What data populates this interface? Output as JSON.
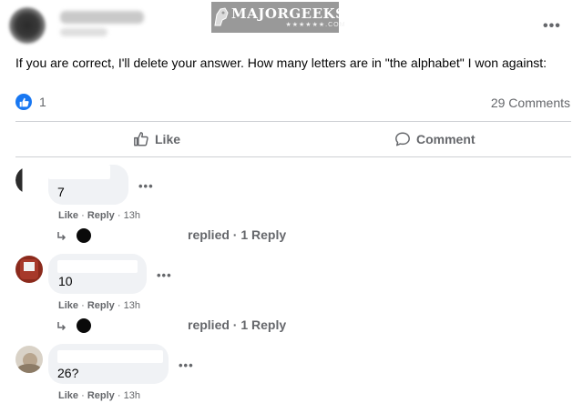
{
  "post": {
    "text": "If you are correct, I'll delete your answer. How many letters are in \"the alphabet\" I won against:",
    "reaction_count": "1",
    "comment_count": "29 Comments",
    "more_icon": "ellipsis-icon"
  },
  "watermark": {
    "main": "MAJORGEEKS",
    "sub": "★★★★★★.COM"
  },
  "actions": {
    "like_label": "Like",
    "comment_label": "Comment"
  },
  "comments": [
    {
      "text": "7",
      "like_label": "Like",
      "reply_label": "Reply",
      "time": "13h",
      "replied_text": "replied · 1 Reply"
    },
    {
      "text": "10",
      "like_label": "Like",
      "reply_label": "Reply",
      "time": "13h",
      "replied_text": "replied · 1 Reply"
    },
    {
      "text": "26?",
      "like_label": "Like",
      "reply_label": "Reply",
      "time": "13h"
    }
  ],
  "colors": {
    "accent": "#1877f2",
    "muted_text": "#65676b",
    "bubble": "#f0f2f5",
    "divider": "#ced0d4"
  }
}
